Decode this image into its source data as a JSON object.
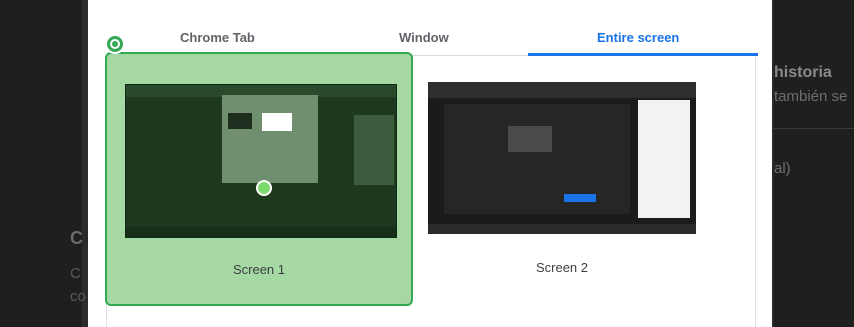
{
  "background": {
    "left_heading_fragment": "C",
    "left_text_line1": "C",
    "left_text_line2": "co",
    "right_title_fragment": "historia",
    "right_sub_fragment": "también se",
    "right_item_fragment": "al)"
  },
  "dialog": {
    "tabs": [
      {
        "label": "Chrome Tab"
      },
      {
        "label": "Window"
      },
      {
        "label": "Entire screen"
      }
    ],
    "selected_tab": "Entire screen",
    "screens": [
      {
        "label": "Screen 1"
      },
      {
        "label": "Screen 2"
      }
    ],
    "selected_screen": "Screen 1"
  },
  "colors": {
    "accent": "#1a73e8",
    "selected_fill": "#a6d8a4",
    "selected_border": "#34a853"
  },
  "icons": {
    "selected_badge": "target-icon"
  }
}
